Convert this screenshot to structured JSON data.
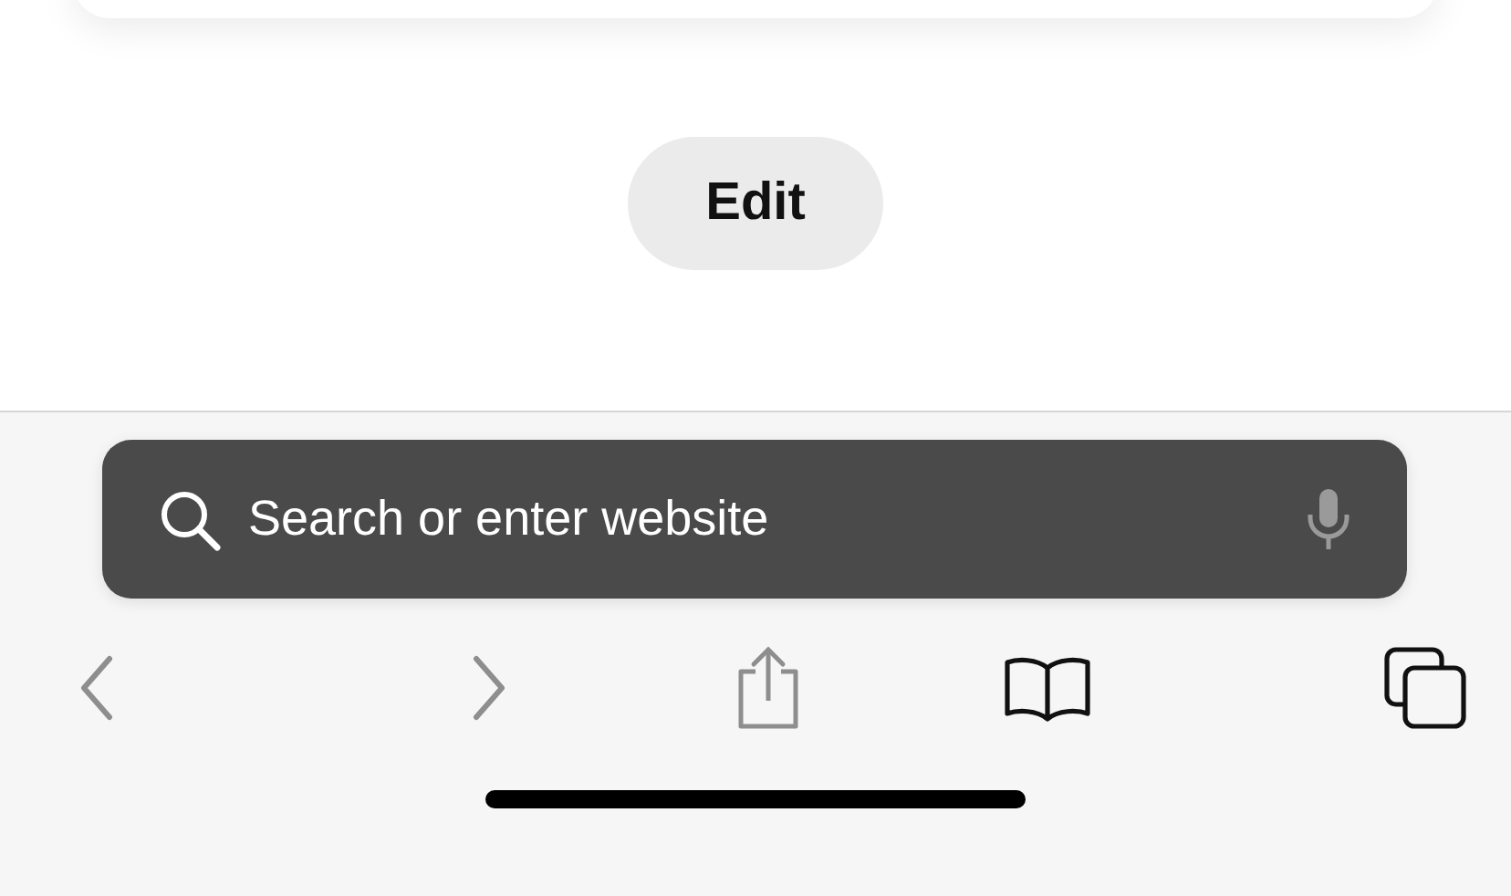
{
  "edit_button": {
    "label": "Edit"
  },
  "address_bar": {
    "placeholder": "Search or enter website"
  },
  "toolbar": [
    {
      "kind": "back",
      "disabled": true
    },
    {
      "kind": "forward",
      "disabled": true
    },
    {
      "kind": "share",
      "disabled": true
    },
    {
      "kind": "bookmarks",
      "disabled": false
    },
    {
      "kind": "tabs",
      "disabled": false
    }
  ]
}
